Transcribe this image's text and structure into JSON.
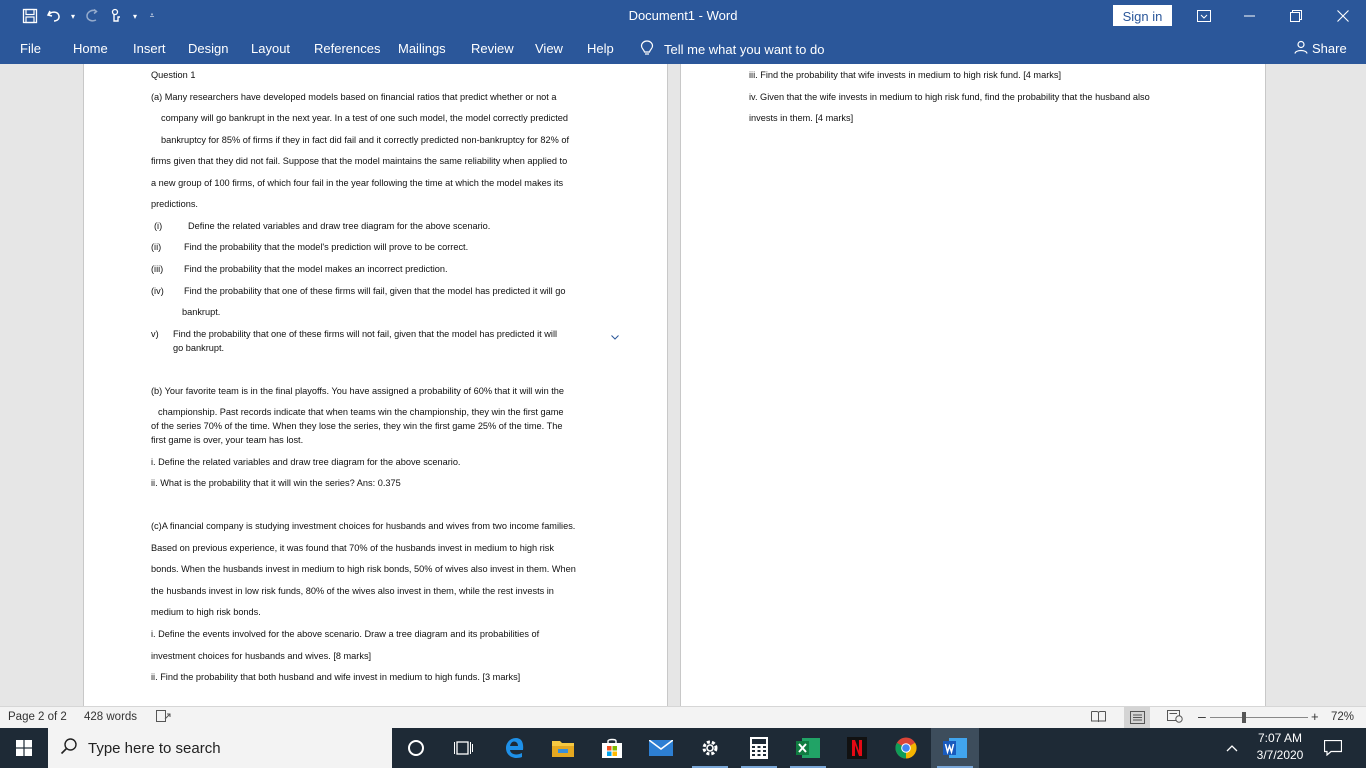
{
  "window": {
    "title": "Document1  -  Word",
    "signin_label": "Sign in"
  },
  "ribbon": {
    "tabs": [
      "File",
      "Home",
      "Insert",
      "Design",
      "Layout",
      "References",
      "Mailings",
      "Review",
      "View",
      "Help"
    ],
    "tell_me": "Tell me what you want to do",
    "share": "Share"
  },
  "page1": {
    "lines": [
      "Question 1",
      "(a) Many researchers have developed models based on financial ratios that predict whether or not a",
      "company will go bankrupt in the next year. In a test of one such model, the model correctly predicted",
      "bankruptcy for 85% of firms if they in fact did fail and it correctly predicted non-bankruptcy for 82% of",
      "firms given that they did not fail. Suppose that the model maintains the same reliability when applied to",
      "a new group of 100 firms, of which four fail in the year following the time at which the model makes its",
      "predictions.",
      "(i)",
      "Define the related variables and draw tree diagram for the above scenario.",
      "(ii)",
      "Find the probability that the model's prediction will prove to be correct.",
      "(iii)",
      "Find the probability that the model makes an incorrect prediction.",
      "(iv)",
      "Find the probability that one of these firms will fail, given that the model has predicted it will go",
      "bankrupt.",
      "v)",
      "Find the probability that one of these firms will not fail, given that the model has predicted it will",
      "go bankrupt.",
      "(b) Your favorite team is in the final playoffs. You have assigned a probability of 60% that it will win the",
      "championship. Past records indicate that when teams win the championship, they win the first game",
      "of the series 70% of the time. When they lose the series, they win the first game 25% of the time. The",
      "first game is over, your team has lost.",
      "i. Define the related variables and draw tree diagram for the above scenario.",
      "ii. What is the probability that it will win the series? Ans: 0.375",
      "(c)A financial company is studying investment choices for husbands and wives from two income families.",
      "Based on previous experience, it was found that 70% of the husbands invest in medium to high risk",
      "bonds. When the husbands invest in medium to high risk bonds, 50% of wives also invest in them. When",
      "the husbands invest in low risk funds, 80% of the wives also invest in them, while the rest invests in",
      "medium to high risk bonds.",
      "i. Define the events involved for the above scenario. Draw a tree diagram and its probabilities of",
      "investment choices for husbands and wives. [8 marks]",
      "ii. Find the probability that both husband and wife invest in medium to high funds. [3 marks]"
    ]
  },
  "page2": {
    "lines": [
      "iii. Find the probability that wife invests in medium to high risk fund. [4 marks]",
      "iv. Given that the wife invests in medium to high risk fund, find the probability that the husband also",
      "invests in them. [4 marks]"
    ]
  },
  "status": {
    "page": "Page 2 of 2",
    "words": "428 words",
    "zoom": "72%"
  },
  "taskbar": {
    "search_placeholder": "Type here to search",
    "time": "7:07 AM",
    "date": "3/7/2020"
  },
  "colors": {
    "word_blue": "#2b579a",
    "taskbar": "#1e2a36"
  }
}
